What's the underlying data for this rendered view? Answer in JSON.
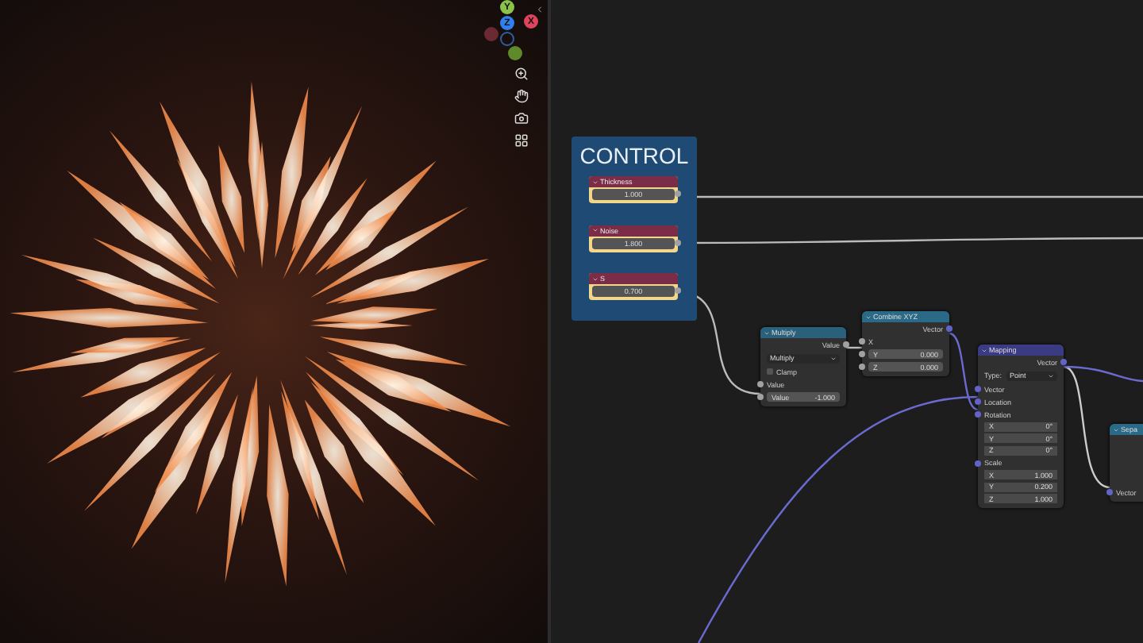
{
  "viewport": {
    "gizmo": [
      {
        "axis": "Y",
        "color": "#8bc34a"
      },
      {
        "axis": "Z",
        "color": "#2f80ed"
      },
      {
        "axis": "X",
        "color": "#e0445c"
      }
    ]
  },
  "frame": {
    "title": "CONTROL",
    "nodes": [
      {
        "title": "Thickness",
        "value": "1.000"
      },
      {
        "title": "Noise",
        "value": "1.800"
      },
      {
        "title": "S",
        "value": "0.700"
      }
    ]
  },
  "nodes": [
    {
      "title": "Multiply",
      "color": "#2a6079",
      "rows": [
        {
          "kind": "output",
          "label": "Value",
          "color": "#a1a1a1"
        },
        {
          "kind": "dropdown",
          "value": "Multiply"
        },
        {
          "kind": "checkbox",
          "label": "Clamp",
          "checked": false
        },
        {
          "kind": "input",
          "label": "Value",
          "color": "#a1a1a1"
        },
        {
          "kind": "field",
          "label": "Value",
          "value": "-1.000",
          "color": "#a1a1a1"
        }
      ]
    },
    {
      "title": "Combine XYZ",
      "color": "#2a6a86",
      "rows": [
        {
          "kind": "output",
          "label": "Vector",
          "color": "#6363c7"
        },
        {
          "kind": "input",
          "label": "X",
          "color": "#a1a1a1"
        },
        {
          "kind": "field",
          "label": "Y",
          "value": "0.000",
          "color": "#a1a1a1"
        },
        {
          "kind": "field",
          "label": "Z",
          "value": "0.000",
          "color": "#a1a1a1"
        }
      ]
    },
    {
      "title": "Mapping",
      "color": "#3b3b84",
      "rows": [
        {
          "kind": "output",
          "label": "Vector",
          "color": "#6363c7"
        },
        {
          "kind": "dropdown",
          "label": "Type:",
          "value": "Point"
        },
        {
          "kind": "input",
          "label": "Vector",
          "color": "#6363c7"
        },
        {
          "kind": "input",
          "label": "Location",
          "color": "#6363c7"
        },
        {
          "kind": "input",
          "label": "Rotation",
          "color": "#6363c7"
        },
        {
          "kind": "subfield",
          "label": "X",
          "value": "0°"
        },
        {
          "kind": "subfield",
          "label": "Y",
          "value": "0°"
        },
        {
          "kind": "subfield",
          "label": "Z",
          "value": "0°"
        },
        {
          "kind": "input",
          "label": "Scale",
          "color": "#6363c7"
        },
        {
          "kind": "subfield",
          "label": "X",
          "value": "1.000"
        },
        {
          "kind": "subfield",
          "label": "Y",
          "value": "0.200"
        },
        {
          "kind": "subfield",
          "label": "Z",
          "value": "1.000"
        }
      ]
    },
    {
      "title": "Sepa",
      "color": "#2a6a86",
      "rows": [
        {
          "kind": "spacer"
        },
        {
          "kind": "spacer"
        },
        {
          "kind": "spacer"
        },
        {
          "kind": "spacer"
        },
        {
          "kind": "input",
          "label": "Vector",
          "color": "#6363c7"
        }
      ]
    }
  ]
}
